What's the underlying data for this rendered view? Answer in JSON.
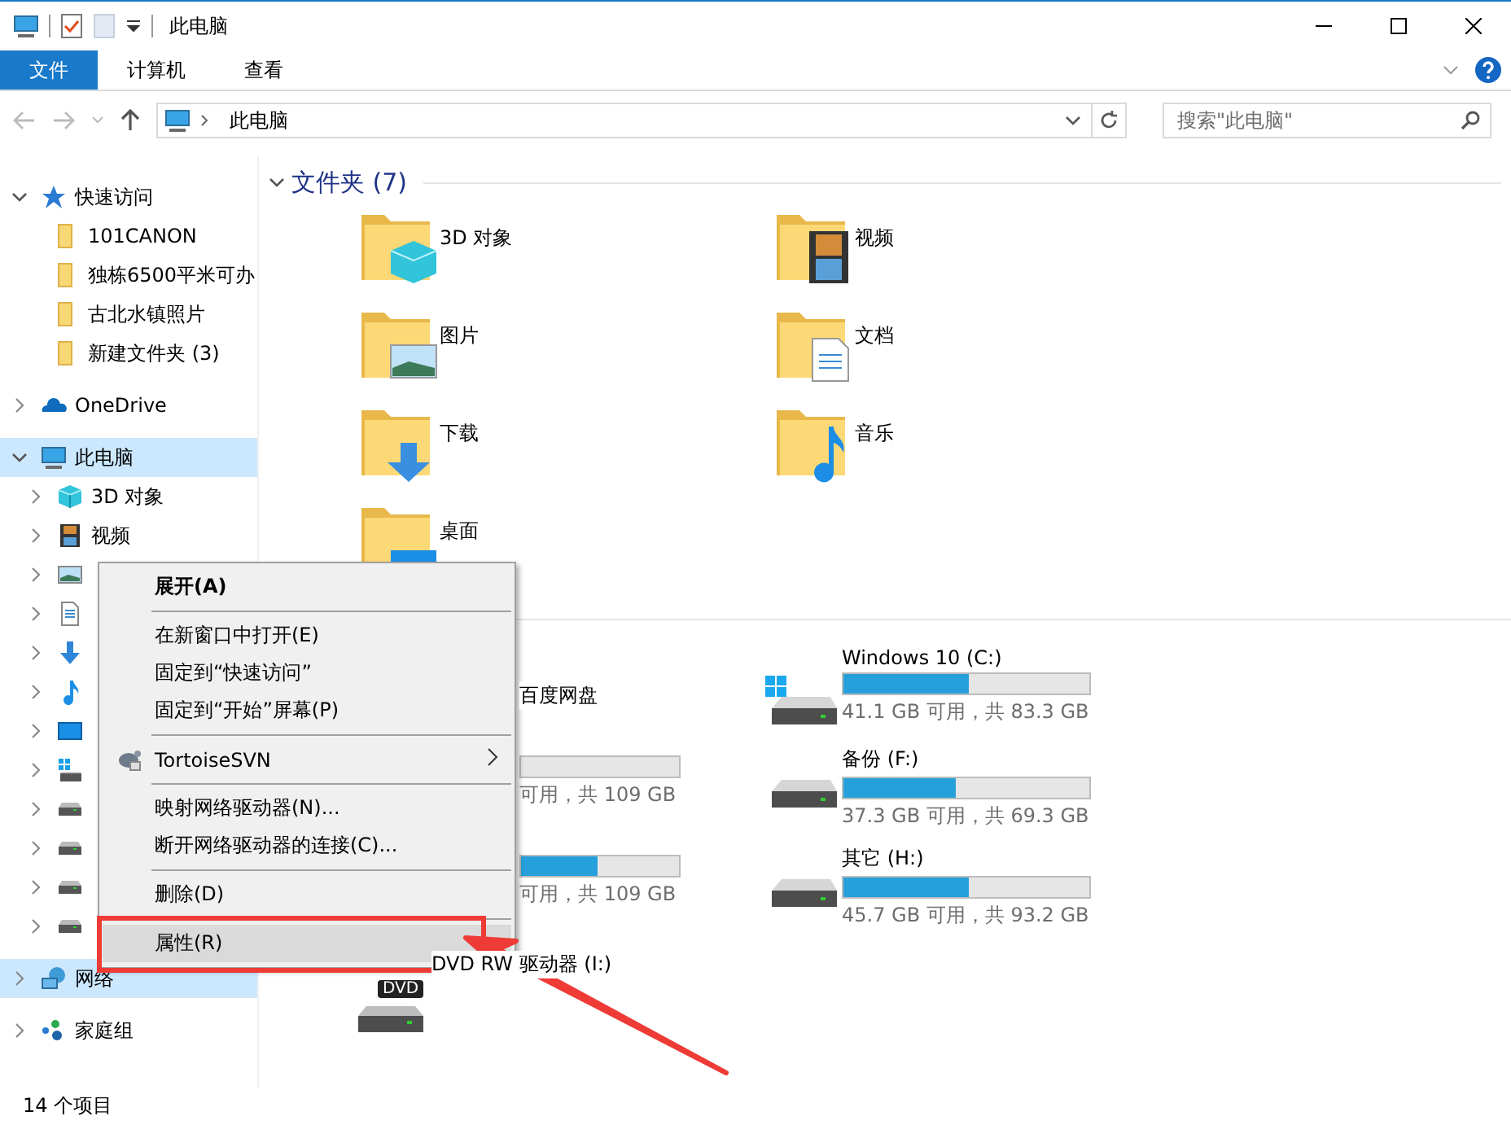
{
  "window": {
    "title": "此电脑"
  },
  "ribbon_tabs": [
    {
      "label": "文件",
      "selected": true
    },
    {
      "label": "计算机",
      "selected": false
    },
    {
      "label": "查看",
      "selected": false
    }
  ],
  "address_bar": {
    "path": "此电脑"
  },
  "search": {
    "placeholder": "搜索\"此电脑\""
  },
  "sidebar": [
    {
      "label": "快速访问",
      "kind": "star",
      "expanded": true,
      "selected": false,
      "children": [
        {
          "label": "101CANON",
          "kind": "folder"
        },
        {
          "label": "独栋6500平米可办",
          "kind": "folder"
        },
        {
          "label": "古北水镇照片",
          "kind": "folder"
        },
        {
          "label": "新建文件夹 (3)",
          "kind": "folder"
        }
      ]
    },
    {
      "label": "OneDrive",
      "kind": "cloud",
      "expanded": false,
      "selected": false
    },
    {
      "label": "此电脑",
      "kind": "pc",
      "expanded": true,
      "selected": true,
      "children": [
        {
          "label": "3D 对象",
          "kind": "cube",
          "expanded": false
        },
        {
          "label": "视频",
          "kind": "film",
          "expanded": false
        },
        {
          "kind": "pictures",
          "expanded": false
        },
        {
          "kind": "document",
          "expanded": false
        },
        {
          "kind": "download",
          "expanded": false
        },
        {
          "kind": "music",
          "expanded": false
        },
        {
          "kind": "desktop",
          "expanded": false
        },
        {
          "kind": "windrive",
          "expanded": false
        },
        {
          "kind": "drive",
          "expanded": false
        },
        {
          "kind": "drive",
          "expanded": false
        },
        {
          "kind": "drive",
          "expanded": false
        },
        {
          "kind": "drive",
          "expanded": false
        }
      ]
    },
    {
      "label": "网络",
      "kind": "network",
      "expanded": false,
      "selected": true
    },
    {
      "label": "家庭组",
      "kind": "homegroup",
      "expanded": false,
      "selected": false
    }
  ],
  "folders": {
    "heading": "文件夹 (7)",
    "expanded": true,
    "items": [
      {
        "label": "3D 对象",
        "kind": "cube"
      },
      {
        "label": "图片",
        "kind": "pictures"
      },
      {
        "label": "下载",
        "kind": "download"
      },
      {
        "label": "桌面",
        "kind": "desktop"
      },
      {
        "label": "视频",
        "kind": "film"
      },
      {
        "label": "文档",
        "kind": "document"
      },
      {
        "label": "音乐",
        "kind": "music"
      }
    ]
  },
  "drives": [
    {
      "kind": "cloud",
      "covered": true,
      "label": "百度网盘"
    },
    {
      "kind": "drive",
      "covered": true,
      "level": 0,
      "reading": "可用，共 109 GB"
    },
    {
      "kind": "drive",
      "covered": true,
      "level": 0.48,
      "reading": "可用，共 109 GB"
    },
    {
      "kind": "dvd",
      "covered": false,
      "label": "DVD RW 驱动器 (I:)",
      "badge": "DVD"
    },
    {
      "kind": "windrive",
      "covered": false,
      "label": "Windows 10 (C:)",
      "level": 0.51,
      "reading": "41.1 GB 可用，共 83.3 GB"
    },
    {
      "kind": "drive",
      "covered": false,
      "label": "备份 (F:)",
      "level": 0.46,
      "reading": "37.3 GB 可用，共 69.3 GB"
    },
    {
      "kind": "drive",
      "covered": false,
      "label": "其它 (H:)",
      "level": 0.51,
      "reading": "45.7 GB 可用，共 93.2 GB"
    }
  ],
  "context_menu": {
    "items": [
      {
        "kind": "item",
        "label": "展开(A)",
        "default": true,
        "selected": false
      },
      {
        "kind": "separator"
      },
      {
        "kind": "item",
        "label": "在新窗口中打开(E)",
        "default": false,
        "selected": false
      },
      {
        "kind": "item",
        "label": "固定到“快速访问”",
        "default": false,
        "selected": false
      },
      {
        "kind": "item",
        "label": "固定到“开始”屏幕(P)",
        "default": false,
        "selected": false
      },
      {
        "kind": "separator"
      },
      {
        "kind": "submenu",
        "label": "TortoiseSVN",
        "default": false,
        "selected": false
      },
      {
        "kind": "separator"
      },
      {
        "kind": "item",
        "label": "映射网络驱动器(N)...",
        "default": false,
        "selected": false
      },
      {
        "kind": "item",
        "label": "断开网络驱动器的连接(C)...",
        "default": false,
        "selected": false
      },
      {
        "kind": "separator"
      },
      {
        "kind": "item",
        "label": "删除(D)",
        "default": false,
        "selected": false
      },
      {
        "kind": "separator"
      },
      {
        "kind": "item",
        "label": "属性(R)",
        "default": false,
        "selected": true
      }
    ]
  },
  "status_bar": {
    "count": "14 个项目"
  }
}
